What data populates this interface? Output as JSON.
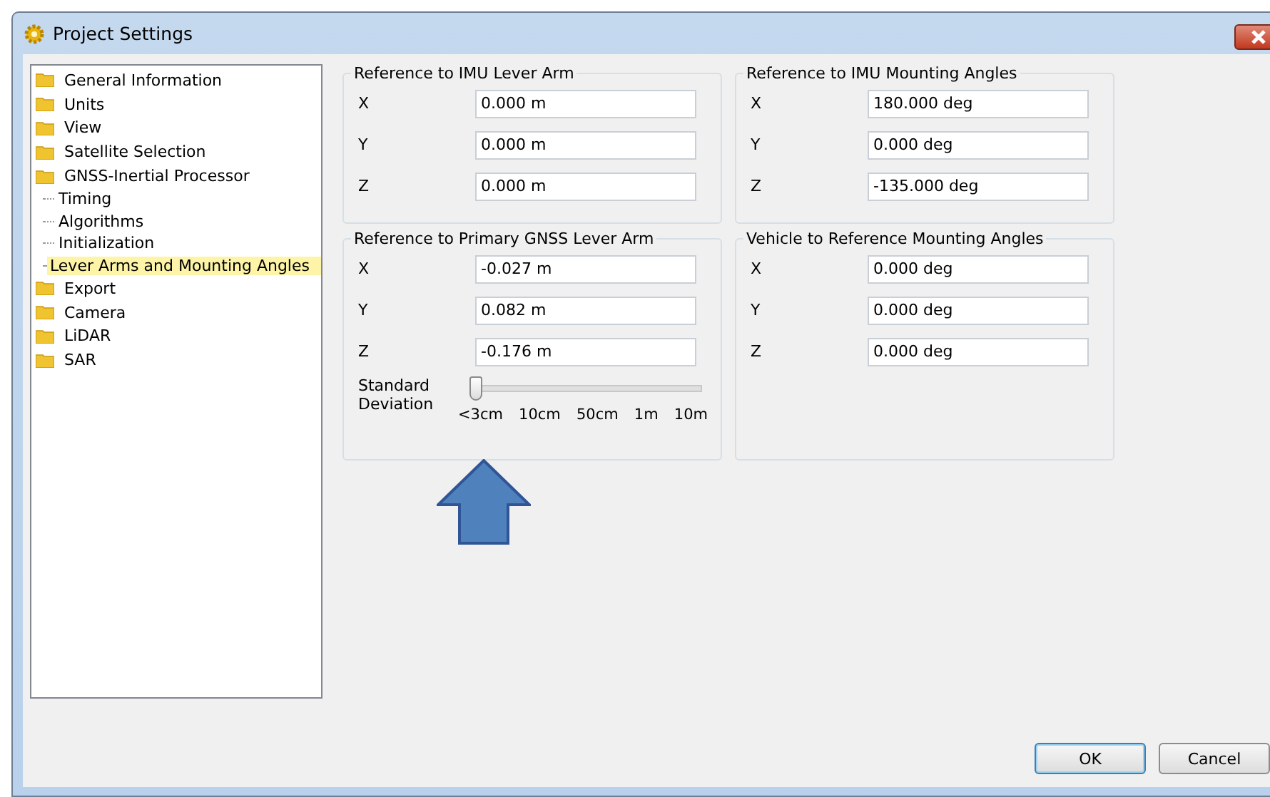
{
  "window": {
    "title": "Project Settings"
  },
  "tree": [
    {
      "label": "General Information",
      "selected": false
    },
    {
      "label": "Units",
      "selected": false
    },
    {
      "label": "View",
      "selected": false
    },
    {
      "label": "Satellite Selection",
      "selected": false
    },
    {
      "label": "GNSS-Inertial Processor",
      "selected": false,
      "children": [
        {
          "label": "Timing",
          "selected": false
        },
        {
          "label": "Algorithms",
          "selected": false
        },
        {
          "label": "Initialization",
          "selected": false
        },
        {
          "label": "Lever Arms and Mounting Angles",
          "selected": true
        }
      ]
    },
    {
      "label": "Export",
      "selected": false
    },
    {
      "label": "Camera",
      "selected": false
    },
    {
      "label": "LiDAR",
      "selected": false
    },
    {
      "label": "SAR",
      "selected": false
    }
  ],
  "groups": [
    {
      "title": "Reference to IMU Lever Arm",
      "fields": [
        {
          "label": "X",
          "value": "0.000 m"
        },
        {
          "label": "Y",
          "value": "0.000 m"
        },
        {
          "label": "Z",
          "value": "0.000 m"
        }
      ]
    },
    {
      "title": "Reference to IMU Mounting Angles",
      "fields": [
        {
          "label": "X",
          "value": "180.000 deg"
        },
        {
          "label": "Y",
          "value": "0.000 deg"
        },
        {
          "label": "Z",
          "value": "-135.000 deg"
        }
      ]
    },
    {
      "title": "Reference to Primary GNSS Lever Arm",
      "fields": [
        {
          "label": "X",
          "value": "-0.027 m"
        },
        {
          "label": "Y",
          "value": "0.082 m"
        },
        {
          "label": "Z",
          "value": "-0.176 m"
        }
      ],
      "slider": {
        "label": "Standard Deviation",
        "level": 0,
        "ticks": [
          "<3cm",
          "10cm",
          "50cm",
          "1m",
          "10m"
        ]
      }
    },
    {
      "title": "Vehicle to Reference Mounting Angles",
      "fields": [
        {
          "label": "X",
          "value": "0.000 deg"
        },
        {
          "label": "Y",
          "value": "0.000 deg"
        },
        {
          "label": "Z",
          "value": "0.000 deg"
        }
      ]
    }
  ],
  "buttons": [
    {
      "label": "OK",
      "default": true
    },
    {
      "label": "Cancel",
      "default": false
    }
  ]
}
